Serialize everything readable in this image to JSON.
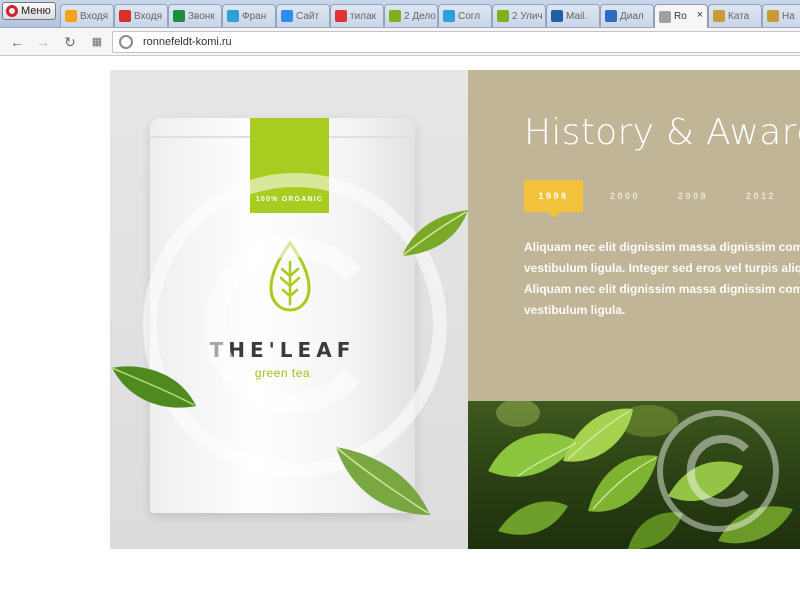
{
  "browser": {
    "menu_label": "Меню",
    "url": "ronnefeldt-komi.ru",
    "tabs": [
      {
        "label": "Входя",
        "icon": "yandex-mail-icon",
        "color": "#f2a21b",
        "active": false
      },
      {
        "label": "Входя",
        "icon": "gmail-icon",
        "color": "#d93025",
        "active": false
      },
      {
        "label": "Звонк",
        "icon": "spreadsheet-icon",
        "color": "#1e8e3e",
        "active": false
      },
      {
        "label": "Фран",
        "icon": "cloud-icon",
        "color": "#2aa1d8",
        "active": false
      },
      {
        "label": "Сайт",
        "icon": "drive-icon",
        "color": "#2d8cf0",
        "active": false
      },
      {
        "label": "тилак",
        "icon": "yandex-icon",
        "color": "#e13333",
        "active": false
      },
      {
        "label": "2 Дело",
        "icon": "number-2-icon",
        "color": "#7fb020",
        "active": false
      },
      {
        "label": "Согл",
        "icon": "cloud-icon",
        "color": "#2aa1d8",
        "active": false
      },
      {
        "label": "2 Улич",
        "icon": "number-2-icon",
        "color": "#7fb020",
        "active": false
      },
      {
        "label": "Mail.",
        "icon": "mail-ru-icon",
        "color": "#1f5fa8",
        "active": false
      },
      {
        "label": "Диал",
        "icon": "chat-icon",
        "color": "#2d6cc0",
        "active": false
      },
      {
        "label": "Ro",
        "icon": "page-icon",
        "color": "#a0a0a0",
        "active": true
      },
      {
        "label": "Ката",
        "icon": "r-logo-icon",
        "color": "#c79a3a",
        "active": false
      },
      {
        "label": "На",
        "icon": "r-logo-icon",
        "color": "#c79a3a",
        "active": false
      }
    ]
  },
  "hero": {
    "pouch_label": "100% ORGANIC",
    "brand": "THE'LEAF",
    "brand_sub": "green tea"
  },
  "awards": {
    "title": "History & Awards",
    "years": [
      "1998",
      "2000",
      "2009",
      "2012"
    ],
    "active_year": "1998",
    "paragraph_lines": [
      "Aliquam nec elit dignissim massa dignissim commodo. In",
      "vestibulum ligula. Integer sed eros vel turpis aliquet",
      "Aliquam nec elit dignissim massa dignissim commodo. In",
      "vestibulum ligula."
    ]
  },
  "colors": {
    "accent_yellow": "#f2c23b",
    "panel_tan": "#c1b597",
    "leaf_green": "#a8cc1f"
  }
}
